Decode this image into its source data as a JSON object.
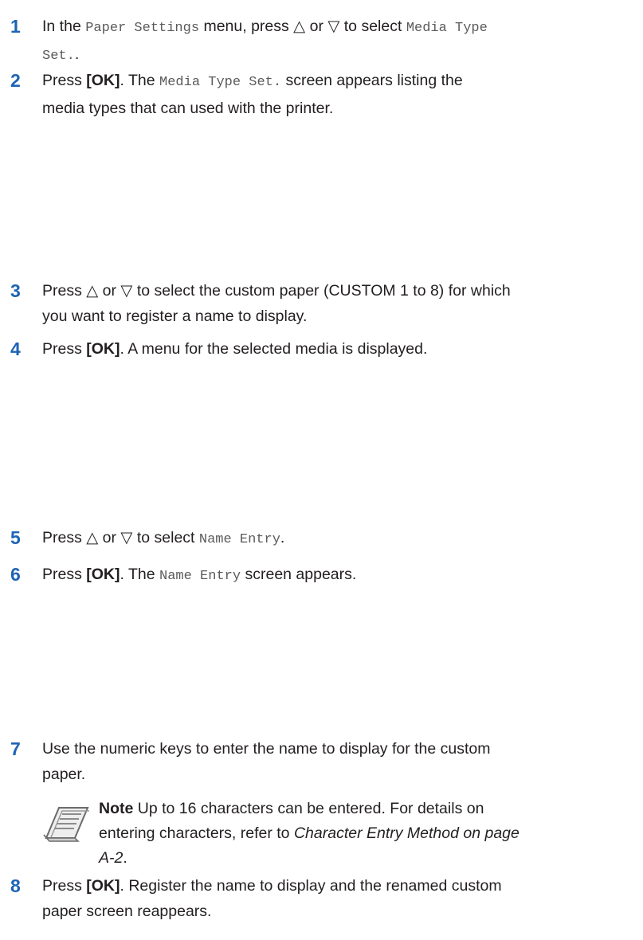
{
  "steps": {
    "s1": {
      "num": "1",
      "t1": "In the ",
      "c1": "Paper Settings",
      "t2": " menu, press △ or ▽ to select ",
      "c2": "Media Type",
      "c3": "Set.",
      "t3": "."
    },
    "s2": {
      "num": "2",
      "t1": "Press ",
      "b1": "[OK]",
      "t2": ". The ",
      "c1": "Media Type Set.",
      "t3": " screen appears listing the",
      "t4": "media types that can used with the printer."
    },
    "s3": {
      "num": "3",
      "line1": "Press △ or ▽ to select the custom paper (CUSTOM 1 to 8) for which",
      "line2": "you want to register a name to display."
    },
    "s4": {
      "num": "4",
      "t1": "Press ",
      "b1": "[OK]",
      "t2": ". A menu for the selected media is displayed."
    },
    "s5": {
      "num": "5",
      "t1": "Press △ or ▽ to select ",
      "c1": "Name Entry",
      "t2": "."
    },
    "s6": {
      "num": "6",
      "t1": "Press ",
      "b1": "[OK]",
      "t2": ". The ",
      "c1": "Name Entry",
      "t3": " screen appears."
    },
    "s7": {
      "num": "7",
      "line1": "Use the numeric keys to enter the name to display for the custom",
      "line2": "paper."
    },
    "s8": {
      "num": "8",
      "t1": "Press ",
      "b1": "[OK]",
      "t2": ". Register the name to display and the renamed custom",
      "line2": "paper screen reappears."
    }
  },
  "note": {
    "icon": "note-icon",
    "label": "Note",
    "t1": "  Up to 16 characters can be entered. For details on",
    "t2": "entering characters, refer to ",
    "link": "Character Entry Method on page",
    "link2": "A-2",
    "t3": "."
  }
}
